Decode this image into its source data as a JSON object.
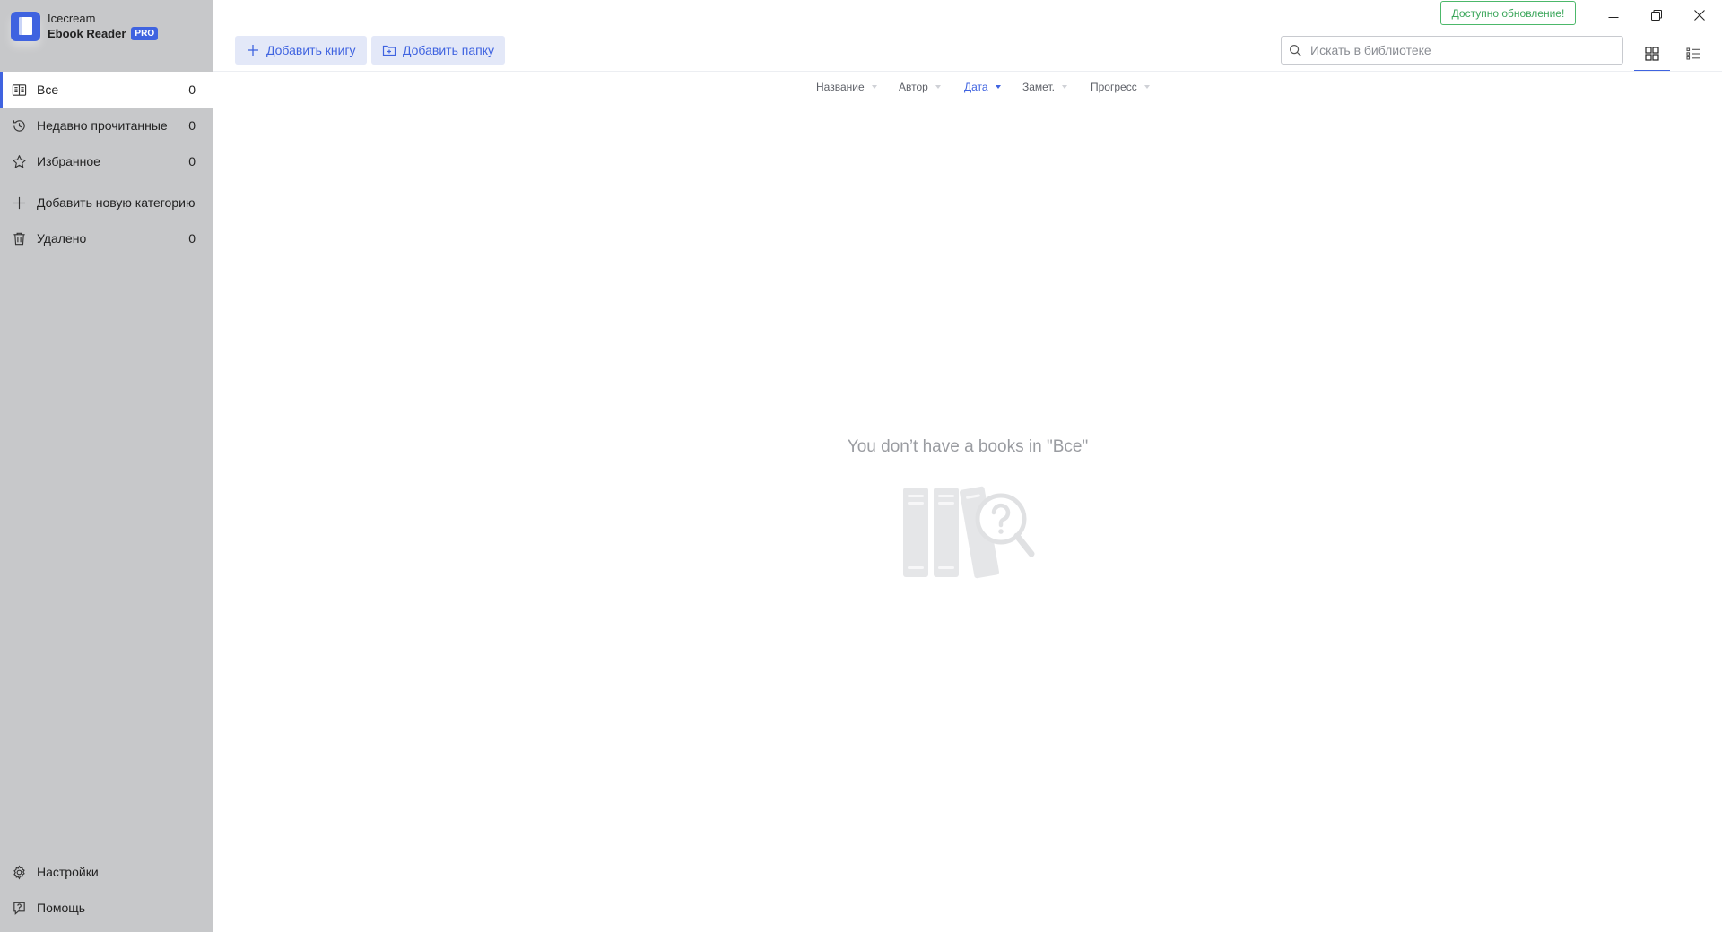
{
  "brand": {
    "line1": "Icecream",
    "line2": "Ebook Reader",
    "badge": "PRO",
    "accent_color": "#3f63e0"
  },
  "sidebar": {
    "items": [
      {
        "label": "Все",
        "count": "0",
        "icon": "book-open-icon",
        "active": true
      },
      {
        "label": "Недавно прочитанные",
        "count": "0",
        "icon": "history-icon"
      },
      {
        "label": "Избранное",
        "count": "0",
        "icon": "star-icon"
      },
      {
        "label": "Добавить новую категорию",
        "icon": "plus-icon"
      },
      {
        "label": "Удалено",
        "count": "0",
        "icon": "trash-icon"
      }
    ],
    "bottom": [
      {
        "label": "Настройки",
        "icon": "gear-icon"
      },
      {
        "label": "Помощь",
        "icon": "help-icon"
      }
    ]
  },
  "topbar": {
    "update_label": "Доступно обновление!",
    "add_book_label": "Добавить книгу",
    "add_folder_label": "Добавить папку",
    "search_placeholder": "Искать в библиотеке",
    "update_color": "#3aa65a"
  },
  "sort": {
    "columns": [
      "Название",
      "Автор",
      "Дата",
      "Замет.",
      "Прогресс"
    ],
    "active": "Дата"
  },
  "empty_state": {
    "message": "You don’t have a books in \"Все\""
  }
}
